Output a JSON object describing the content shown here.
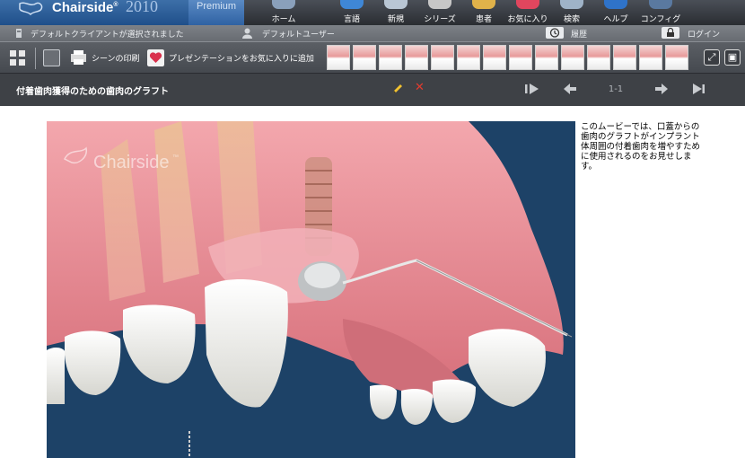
{
  "app": {
    "brand": "Chairside",
    "trademark": "®",
    "year": "2010",
    "edition": "Premium"
  },
  "nav": [
    {
      "id": "home",
      "label": "ホーム",
      "icon": "home-icon"
    },
    {
      "id": "language",
      "label": "言語",
      "icon": "language-icon"
    },
    {
      "id": "new",
      "label": "新規",
      "icon": "new-icon"
    },
    {
      "id": "series",
      "label": "シリーズ",
      "icon": "series-icon"
    },
    {
      "id": "patient",
      "label": "患者",
      "icon": "patient-icon"
    },
    {
      "id": "favorites",
      "label": "お気に入り",
      "icon": "favorites-icon"
    },
    {
      "id": "search",
      "label": "検索",
      "icon": "search-icon"
    },
    {
      "id": "help",
      "label": "ヘルプ",
      "icon": "help-icon"
    },
    {
      "id": "config",
      "label": "コンフィグ",
      "icon": "gear-icon"
    }
  ],
  "infobar": {
    "client_status": "デフォルトクライアントが選択されました",
    "user": "デフォルトユーザー",
    "history": "履歴",
    "login": "ログイン"
  },
  "toolbar": {
    "print_scene": "シーンの印刷",
    "add_favorite": "プレゼンテーションをお気に入りに追加",
    "thumbnail_count": 14
  },
  "presentation": {
    "title": "付着歯肉獲得のための歯肉のグラフト",
    "page_indicator": "1-1"
  },
  "scene": {
    "watermark": "Chairside",
    "watermark_mark": "™"
  },
  "description": "このムービーでは、口蓋からの歯肉のグラフトがインプラント体周囲の付着歯肉を増やすために使用されるのをお見せします。",
  "colors": {
    "header_dark": "#2a2d32",
    "brand_blue": "#1f4f8a",
    "toolbar": "#45494f",
    "title_bar": "#3e4146",
    "scene_bg": "#1d4267",
    "delete_red": "#e23b2e",
    "edit_yellow": "#f2c230"
  }
}
